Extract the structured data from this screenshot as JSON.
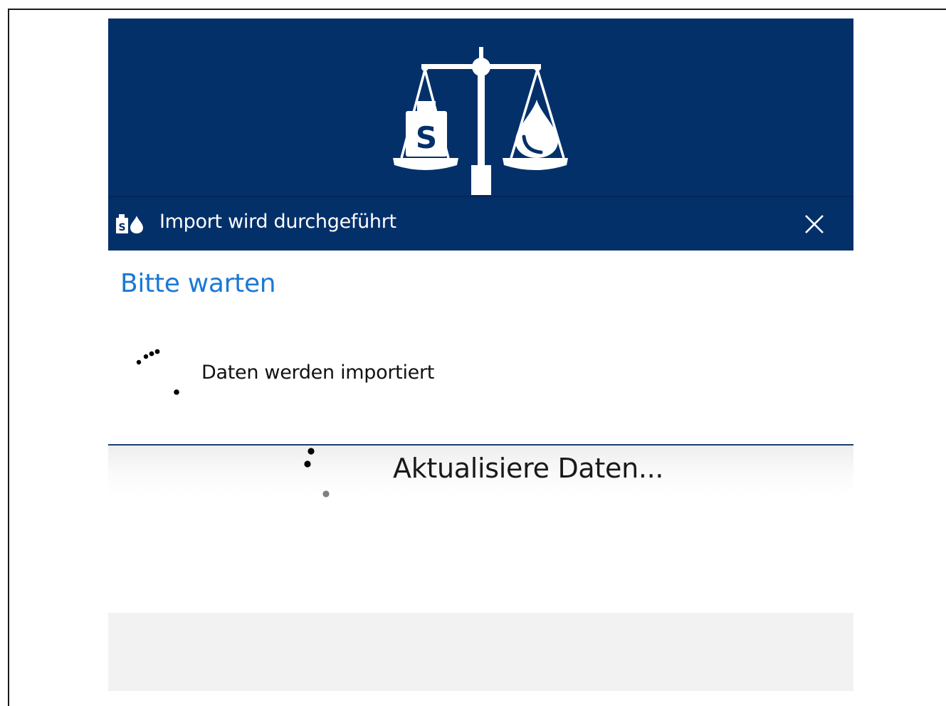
{
  "window": {
    "title": "Import wird durchgeführt",
    "close_icon": "close-icon",
    "app_icon": "weight-and-drop-icon",
    "brand_color": "#04306a"
  },
  "banner": {
    "logo": "balance-scale-icon",
    "weight_label": "S"
  },
  "content": {
    "heading": "Bitte warten",
    "heading_color": "#1a78d6",
    "status": "Daten werden importiert",
    "spinner": "loading-spinner-icon"
  },
  "progress": {
    "message": "Aktualisiere Daten...",
    "spinner": "loading-spinner-icon"
  }
}
